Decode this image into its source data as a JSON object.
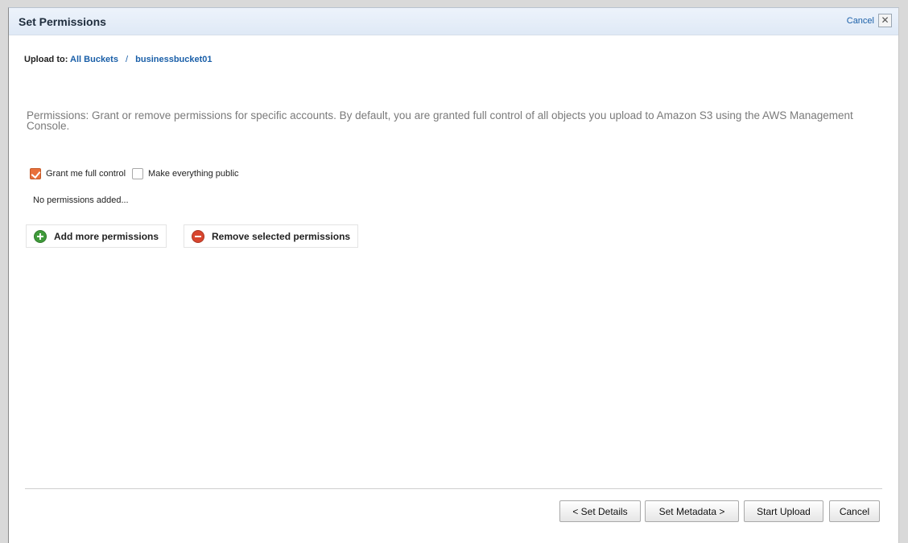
{
  "dialog": {
    "title": "Set Permissions",
    "header_cancel": "Cancel",
    "close_glyph": "✕"
  },
  "breadcrumb": {
    "label": "Upload to:",
    "root": "All Buckets",
    "separator": "/",
    "bucket": "businessbucket01"
  },
  "description": "Permissions: Grant or remove permissions for specific accounts. By default, you are granted full control of all objects you upload to Amazon S3 using the AWS Management Console.",
  "options": {
    "grant_full_control": {
      "label": "Grant me full control",
      "checked": true
    },
    "make_public": {
      "label": "Make everything public",
      "checked": false
    }
  },
  "empty_state": "No permissions added...",
  "actions": {
    "add": {
      "label": "Add more permissions",
      "icon": "add-circle-icon"
    },
    "remove": {
      "label": "Remove selected permissions",
      "icon": "remove-circle-icon"
    }
  },
  "footer": {
    "back": "< Set Details",
    "next": "Set Metadata >",
    "start": "Start Upload",
    "cancel": "Cancel"
  },
  "colors": {
    "link": "#1a5fa8",
    "checkbox_accent": "#e8703a",
    "add_icon": "#3f9a3a",
    "remove_icon": "#d8452e"
  }
}
